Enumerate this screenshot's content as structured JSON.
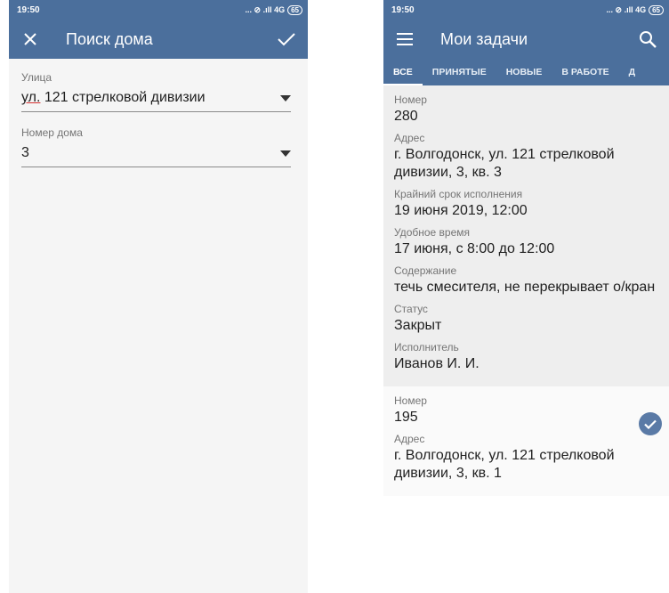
{
  "left": {
    "status": {
      "time": "19:50",
      "indicators": "... ⊘ .ıll 4G",
      "battery": "65"
    },
    "toolbar": {
      "title": "Поиск дома"
    },
    "fields": [
      {
        "label": "Улица",
        "value_prefix": "ул.",
        "value_rest": " 121 стрелковой дивизии"
      },
      {
        "label": "Номер дома",
        "value": "3"
      }
    ]
  },
  "right": {
    "status": {
      "time": "19:50",
      "indicators": "... ⊘ .ıll 4G",
      "battery": "65"
    },
    "toolbar": {
      "title": "Мои задачи"
    },
    "tabs": [
      "ВСЕ",
      "ПРИНЯТЫЕ",
      "НОВЫЕ",
      "В РАБОТЕ",
      "Д"
    ],
    "task1": {
      "number_label": "Номер",
      "number": "280",
      "address_label": "Адрес",
      "address": "г. Волгодонск, ул. 121 стрелковой дивизии, 3, кв. 3",
      "deadline_label": "Крайний срок исполнения",
      "deadline": "19 июня 2019, 12:00",
      "time_label": "Удобное время",
      "time": "17 июня, с 8:00 до 12:00",
      "content_label": "Содержание",
      "content": "течь смесителя, не перекрывает о/кран",
      "status_label": "Статус",
      "status": "Закрыт",
      "executor_label": "Исполнитель",
      "executor": "Иванов И. И."
    },
    "task2": {
      "number_label": "Номер",
      "number": "195",
      "address_label": "Адрес",
      "address": "г. Волгодонск, ул. 121 стрелковой дивизии, 3, кв. 1"
    }
  },
  "colors": {
    "primary": "#4b6f9c",
    "badge": "#5a7aa6"
  }
}
